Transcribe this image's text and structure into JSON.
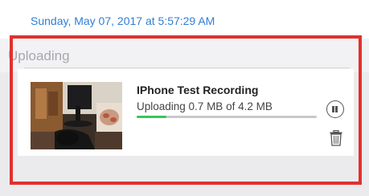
{
  "header": {
    "timestamp": "Sunday, May 07, 2017 at 5:57:29 AM"
  },
  "section": {
    "title": "Uploading"
  },
  "upload": {
    "title": "IPhone Test Recording",
    "status": "Uploading 0.7 MB of 4.2 MB",
    "progress": 0.167
  },
  "icons": {
    "pause": "pause-icon",
    "trash": "trash-icon"
  },
  "colors": {
    "accent_blue": "#2f7fd6",
    "progress_green": "#3cc45a",
    "highlight_red": "#e1312f"
  }
}
